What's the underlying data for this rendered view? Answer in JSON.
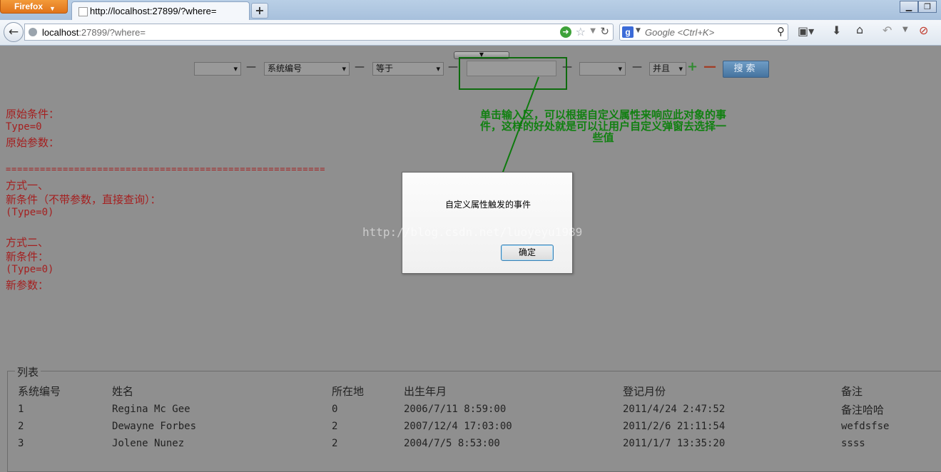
{
  "browser": {
    "menu_label": "Firefox",
    "tab_title": "http://localhost:27899/?where=",
    "new_tab": "+",
    "url_host": "localhost",
    "url_rest": ":27899/?where=",
    "search_placeholder": "Google <Ctrl+K>",
    "search_engine_glyph": "g"
  },
  "filter": {
    "field1_value": "",
    "field2_value": "系统编号",
    "operator_value": "等于",
    "value_input": "",
    "field3_value": "",
    "logic_value": "并且",
    "dash": "—",
    "add_label": "+",
    "remove_label": "—",
    "search_label": "搜索",
    "collapse_glyph": "▼"
  },
  "annotation": "单击输入区，可以根据自定义属性来响应此对象的事件，这样的好处就是可以让用户自定义弹窗去选择一些值",
  "info": {
    "line1": "原始条件：",
    "line2": "Type=0",
    "line3": "原始参数：",
    "separator": "========================================================",
    "line4": "方式一、",
    "line5": "新条件（不带参数，直接查询）：",
    "line6": "(Type=0)",
    "line7": "方式二、",
    "line8": "新条件：",
    "line9": "(Type=0)",
    "line10": "新参数："
  },
  "list": {
    "legend": "列表",
    "headers": [
      "系统编号",
      "姓名",
      "所在地",
      "出生年月",
      "登记月份",
      "备注"
    ],
    "rows": [
      [
        "1",
        "Regina Mc Gee",
        "0",
        "2006/7/11 8:59:00",
        "2011/4/24 2:47:52",
        "备注哈哈"
      ],
      [
        "2",
        "Dewayne Forbes",
        "2",
        "2007/12/4 17:03:00",
        "2011/2/6 21:11:54",
        "wefdsfse"
      ],
      [
        "3",
        "Jolene Nunez",
        "2",
        "2004/7/5 8:53:00",
        "2011/1/7 13:35:20",
        "ssss"
      ]
    ]
  },
  "dialog": {
    "message": "自定义属性触发的事件",
    "ok_label": "确定"
  },
  "watermark": "http://blog.csdn.net/luoyeyu1989",
  "colors": {
    "overlay": "#8f8f8f",
    "info_text": "#a51f1f",
    "annotation": "#118011"
  }
}
